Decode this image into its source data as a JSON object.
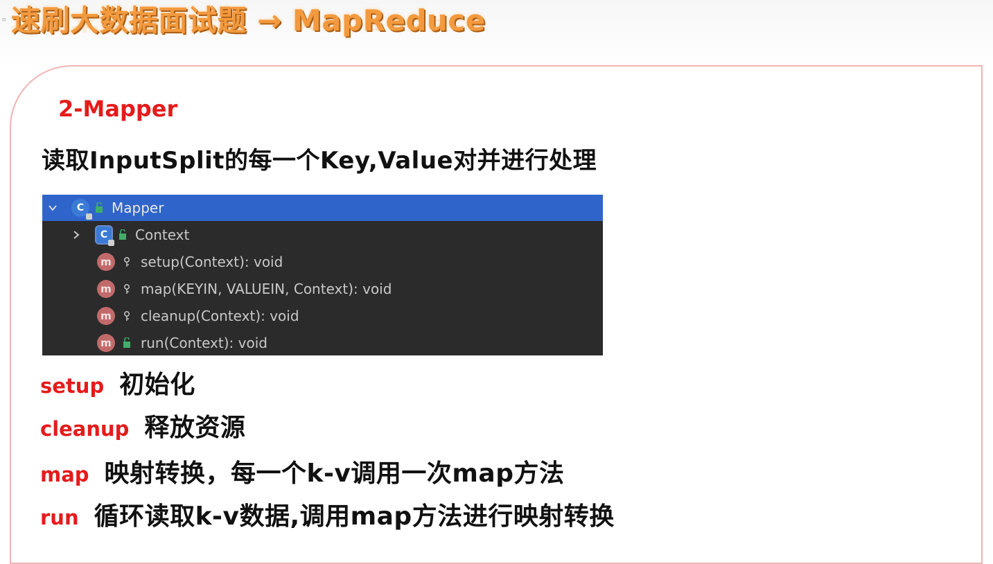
{
  "slide": {
    "title": "速刷大数据面试题 → MapReduce",
    "corner_mark": "≡"
  },
  "section": {
    "heading": "2-Mapper",
    "subtitle": "读取InputSplit的每一个Key,Value对并进行处理"
  },
  "structure_panel": {
    "accent_color": "#2f65ca",
    "background_color": "#2b2b2b",
    "rows": [
      {
        "label": "Mapper",
        "icon": "class-icon",
        "expander": "chevron-down-icon",
        "visibility": "public-icon",
        "selected": true
      },
      {
        "label": "Context",
        "icon": "class-icon",
        "expander": "chevron-right-icon",
        "visibility": "public-icon",
        "selected": false
      },
      {
        "label": "setup(Context): void",
        "icon": "method-icon",
        "visibility": "protected-key-icon",
        "selected": false
      },
      {
        "label": "map(KEYIN, VALUEIN, Context): void",
        "icon": "method-icon",
        "visibility": "protected-key-icon",
        "selected": false
      },
      {
        "label": "cleanup(Context): void",
        "icon": "method-icon",
        "visibility": "protected-key-icon",
        "selected": false
      },
      {
        "label": "run(Context): void",
        "icon": "method-icon",
        "visibility": "public-icon",
        "selected": false
      }
    ],
    "class_icon_letter": "C",
    "method_icon_letter": "m"
  },
  "definitions": [
    {
      "key": "setup",
      "text": "初始化"
    },
    {
      "key": "cleanup",
      "text": "释放资源"
    },
    {
      "key": "map",
      "text": "映射转换，每一个k-v调用一次map方法"
    },
    {
      "key": "run",
      "text": "循环读取k-v数据,调用map方法进行映射转换"
    }
  ],
  "colors": {
    "title_orange": "#f39a3f",
    "heading_red": "#e51b1b",
    "frame_pink": "#f1b3b3"
  }
}
